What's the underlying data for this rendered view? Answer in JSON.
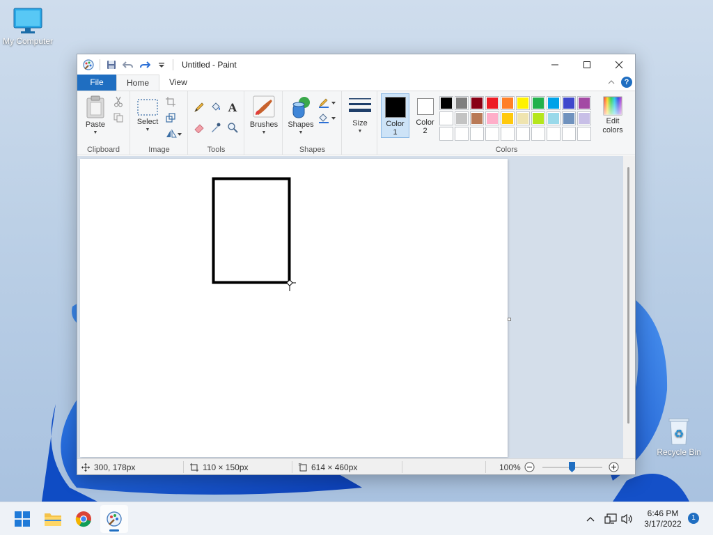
{
  "desktop": {
    "icons": [
      {
        "label": "My Computer"
      },
      {
        "label": "Recycle Bin"
      }
    ]
  },
  "window": {
    "title": "Untitled - Paint",
    "tabs": {
      "file": "File",
      "home": "Home",
      "view": "View"
    },
    "ribbon": {
      "clipboard": {
        "group_label": "Clipboard",
        "paste": "Paste"
      },
      "image": {
        "group_label": "Image",
        "select": "Select"
      },
      "tools": {
        "group_label": "Tools"
      },
      "brushes": {
        "label": "Brushes"
      },
      "shapes": {
        "group_label": "Shapes",
        "label": "Shapes"
      },
      "size": {
        "label": "Size"
      },
      "colors": {
        "group_label": "Colors",
        "color1_line1": "Color",
        "color1_line2": "1",
        "color2_line1": "Color",
        "color2_line2": "2",
        "edit_line1": "Edit",
        "edit_line2": "colors",
        "color1_value": "#000000",
        "color2_value": "#ffffff",
        "palette": [
          "#000000",
          "#7f7f7f",
          "#880015",
          "#ed1c24",
          "#ff7f27",
          "#fff200",
          "#22b14c",
          "#00a2e8",
          "#3f48cc",
          "#a349a4",
          "#ffffff",
          "#c3c3c3",
          "#b97a57",
          "#ffaec9",
          "#ffc90e",
          "#efe4b0",
          "#b5e61d",
          "#99d9ea",
          "#7092be",
          "#c8bfe7",
          "#ffffff",
          "#ffffff",
          "#ffffff",
          "#ffffff",
          "#ffffff",
          "#ffffff",
          "#ffffff",
          "#ffffff",
          "#ffffff",
          "#ffffff"
        ]
      }
    },
    "status": {
      "cursor_pos": "300, 178px",
      "selection_size": "110 × 150px",
      "canvas_size": "614 × 460px",
      "zoom": "100%"
    }
  },
  "taskbar": {
    "time": "6:46 PM",
    "date": "3/17/2022",
    "notifications": "1"
  }
}
